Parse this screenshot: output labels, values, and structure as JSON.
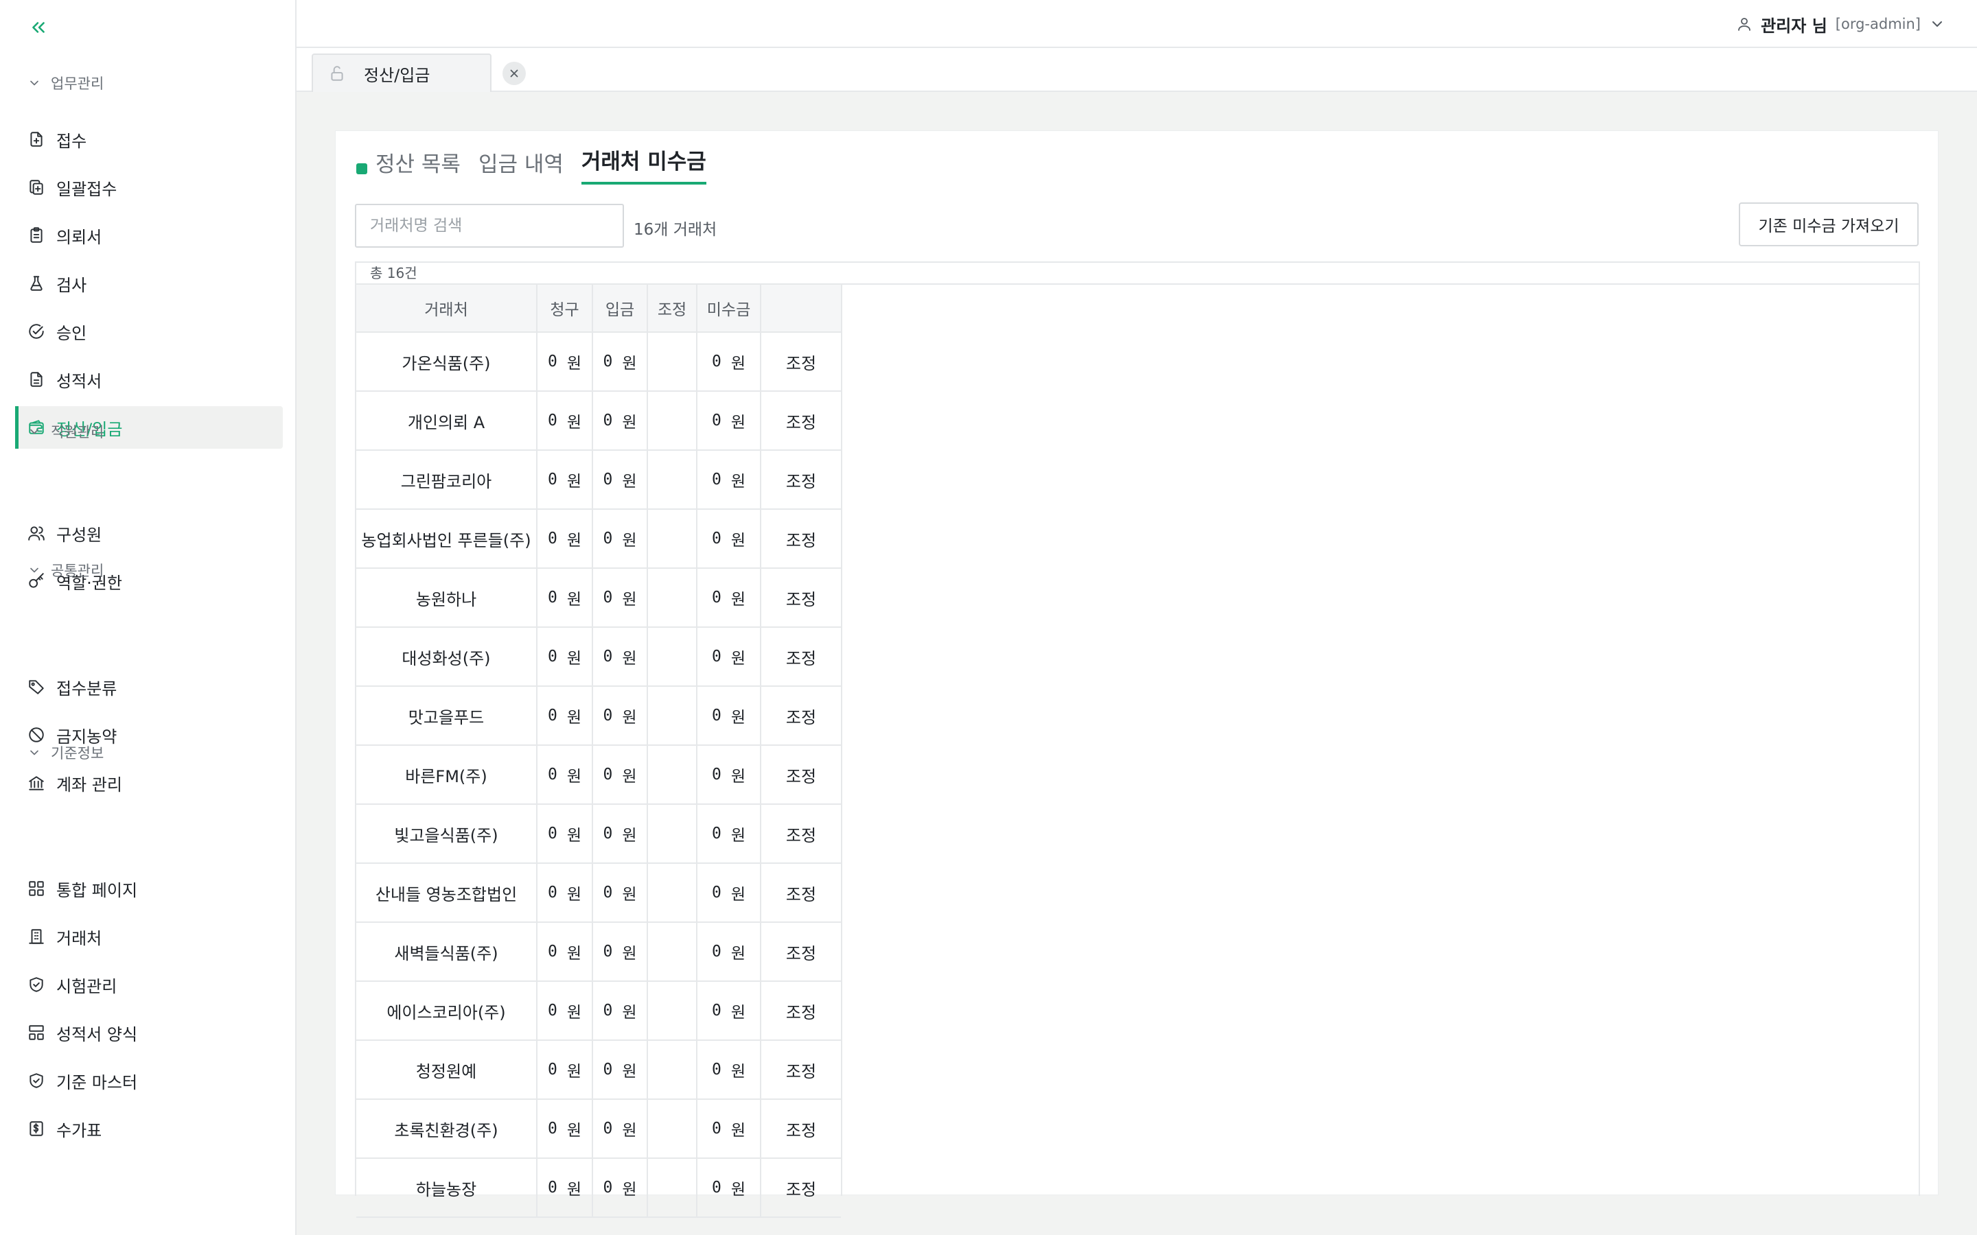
{
  "sidebar": {
    "sections": [
      {
        "title": "업무관리",
        "items": [
          {
            "label": "접수",
            "icon": "file-plus-icon"
          },
          {
            "label": "일괄접수",
            "icon": "files-icon"
          },
          {
            "label": "의뢰서",
            "icon": "clipboard-icon"
          },
          {
            "label": "검사",
            "icon": "flask-icon"
          },
          {
            "label": "승인",
            "icon": "check-circle-icon"
          },
          {
            "label": "성적서",
            "icon": "document-icon"
          },
          {
            "label": "정산/입금",
            "icon": "wallet-icon",
            "active": true
          }
        ]
      },
      {
        "title": "직원관리",
        "items": [
          {
            "label": "구성원",
            "icon": "users-icon"
          },
          {
            "label": "역할·권한",
            "icon": "key-icon"
          }
        ]
      },
      {
        "title": "공통관리",
        "items": [
          {
            "label": "접수분류",
            "icon": "tags-icon"
          },
          {
            "label": "금지농약",
            "icon": "ban-icon"
          },
          {
            "label": "계좌 관리",
            "icon": "bank-icon"
          }
        ]
      },
      {
        "title": "기준정보",
        "items": [
          {
            "label": "통합 페이지",
            "icon": "grid-icon"
          },
          {
            "label": "거래처",
            "icon": "building-icon"
          },
          {
            "label": "시험관리",
            "icon": "shield-check-icon"
          },
          {
            "label": "성적서 양식",
            "icon": "layout-icon"
          },
          {
            "label": "기준 마스터",
            "icon": "shield-check-icon"
          },
          {
            "label": "수가표",
            "icon": "price-sheet-icon"
          }
        ]
      }
    ]
  },
  "topbar": {
    "user_name": "관리자 님",
    "user_role": "[org-admin]"
  },
  "tabstrip": {
    "tab_label": "정산/입금"
  },
  "subtabs": [
    "정산 목록",
    "입금 내역",
    "거래처 미수금"
  ],
  "search": {
    "placeholder": "거래처명 검색",
    "value": ""
  },
  "count_label": "16개 거래처",
  "import_button": "기존 미수금 가져오기",
  "total_label": "총 16건",
  "table": {
    "columns": [
      "거래처",
      "청구",
      "입금",
      "조정",
      "미수금",
      ""
    ],
    "rows": [
      {
        "name": "가온식품(주)",
        "billed": "0",
        "deposit": "0",
        "adjust": "",
        "outstanding": "0",
        "action": "조정"
      },
      {
        "name": "개인의뢰 A",
        "billed": "0",
        "deposit": "0",
        "adjust": "",
        "outstanding": "0",
        "action": "조정"
      },
      {
        "name": "그린팜코리아",
        "billed": "0",
        "deposit": "0",
        "adjust": "",
        "outstanding": "0",
        "action": "조정"
      },
      {
        "name": "농업회사법인 푸른들(주)",
        "billed": "0",
        "deposit": "0",
        "adjust": "",
        "outstanding": "0",
        "action": "조정"
      },
      {
        "name": "농원하나",
        "billed": "0",
        "deposit": "0",
        "adjust": "",
        "outstanding": "0",
        "action": "조정"
      },
      {
        "name": "대성화성(주)",
        "billed": "0",
        "deposit": "0",
        "adjust": "",
        "outstanding": "0",
        "action": "조정"
      },
      {
        "name": "맛고을푸드",
        "billed": "0",
        "deposit": "0",
        "adjust": "",
        "outstanding": "0",
        "action": "조정"
      },
      {
        "name": "바른FM(주)",
        "billed": "0",
        "deposit": "0",
        "adjust": "",
        "outstanding": "0",
        "action": "조정"
      },
      {
        "name": "빛고을식품(주)",
        "billed": "0",
        "deposit": "0",
        "adjust": "",
        "outstanding": "0",
        "action": "조정"
      },
      {
        "name": "산내들 영농조합법인",
        "billed": "0",
        "deposit": "0",
        "adjust": "",
        "outstanding": "0",
        "action": "조정"
      },
      {
        "name": "새벽들식품(주)",
        "billed": "0",
        "deposit": "0",
        "adjust": "",
        "outstanding": "0",
        "action": "조정"
      },
      {
        "name": "에이스코리아(주)",
        "billed": "0",
        "deposit": "0",
        "adjust": "",
        "outstanding": "0",
        "action": "조정"
      },
      {
        "name": "청정원예",
        "billed": "0",
        "deposit": "0",
        "adjust": "",
        "outstanding": "0",
        "action": "조정"
      },
      {
        "name": "초록친환경(주)",
        "billed": "0",
        "deposit": "0",
        "adjust": "",
        "outstanding": "0",
        "action": "조정"
      },
      {
        "name": "하늘농장",
        "billed": "0",
        "deposit": "0",
        "adjust": "",
        "outstanding": "0",
        "action": "조정"
      }
    ],
    "currency_unit": "원"
  },
  "colors": {
    "accent": "#19a974",
    "border": "#e6e8ea",
    "active_bg": "#f0f1f0"
  }
}
